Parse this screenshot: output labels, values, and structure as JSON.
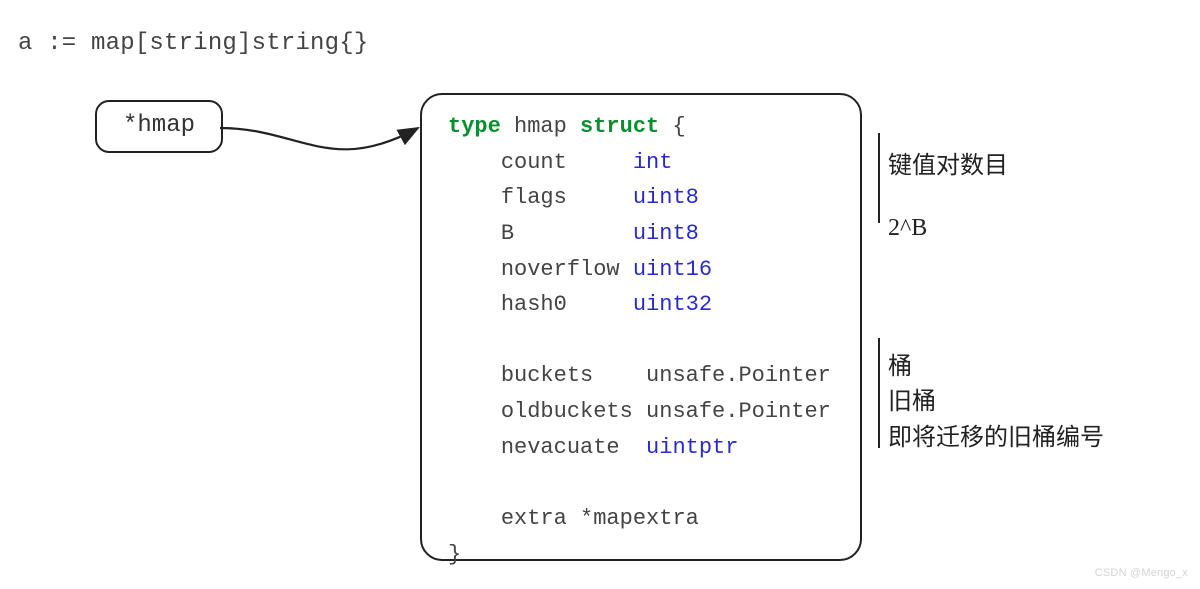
{
  "declaration": "a := map[string]string{}",
  "pointer_label": "*hmap",
  "struct_def": {
    "header": {
      "kw1": "type",
      "name": "hmap",
      "kw2": "struct",
      "open": "{"
    },
    "fields": [
      {
        "name": "count",
        "type": "int",
        "type_colored": true
      },
      {
        "name": "flags",
        "type": "uint8",
        "type_colored": true
      },
      {
        "name": "B",
        "type": "uint8",
        "type_colored": true
      },
      {
        "name": "noverflow",
        "type": "uint16",
        "type_colored": true
      },
      {
        "name": "hash0",
        "type": "uint32",
        "type_colored": true
      },
      {
        "blank": true
      },
      {
        "name": "buckets",
        "type": "unsafe.Pointer",
        "type_colored": false
      },
      {
        "name": "oldbuckets",
        "type": "unsafe.Pointer",
        "type_colored": false
      },
      {
        "name": "nevacuate",
        "type": "uintptr",
        "type_colored": true
      },
      {
        "blank": true
      },
      {
        "name": "extra",
        "type": "*mapextra",
        "type_colored": false,
        "wide": true
      }
    ],
    "close": "}"
  },
  "annotations": {
    "a1": "键值对数目",
    "a2": "2^B",
    "a3": "桶",
    "a4": "旧桶",
    "a5": "即将迁移的旧桶编号"
  },
  "watermark": "CSDN @Mengo_x"
}
